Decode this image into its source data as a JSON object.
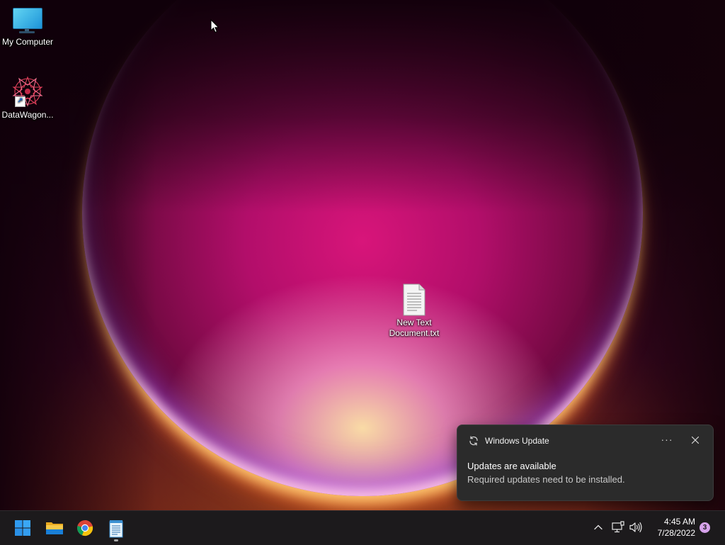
{
  "desktop": {
    "icons": [
      {
        "label": "My Computer",
        "icon": "monitor-icon"
      },
      {
        "label": "DataWagon...",
        "icon": "datawagon-app-icon"
      },
      {
        "label_line1": "New Text",
        "label_line2": "Document.txt",
        "icon": "text-document-icon"
      }
    ]
  },
  "notification": {
    "app_name": "Windows Update",
    "title": "Updates are available",
    "body": "Required updates need to be installed.",
    "more_label": "···",
    "app_icon": "refresh-icon"
  },
  "taskbar": {
    "pinned": [
      {
        "name": "Start",
        "icon": "windows-logo-icon"
      },
      {
        "name": "File Explorer",
        "icon": "folder-icon"
      },
      {
        "name": "Google Chrome",
        "icon": "chrome-icon"
      },
      {
        "name": "Notepad",
        "icon": "notepad-icon",
        "running": true
      }
    ],
    "tray": {
      "icons": [
        "chevron-up-icon",
        "network-icon",
        "volume-icon"
      ],
      "time": "4:45 AM",
      "date": "7/28/2022",
      "notification_count": "3"
    }
  },
  "colors": {
    "toast_bg": "#2b2b2b",
    "taskbar_bg": "#1c1a1c",
    "accent_blue": "#2f9bf0",
    "badge": "#d6a2ea"
  }
}
